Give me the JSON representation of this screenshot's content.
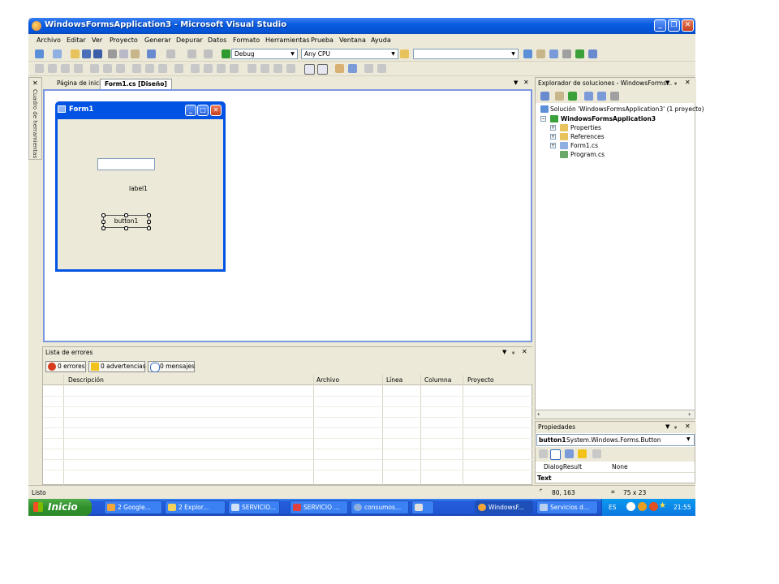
{
  "window": {
    "title": "WindowsFormsApplication3 - Microsoft Visual Studio"
  },
  "menu": [
    "Archivo",
    "Editar",
    "Ver",
    "Proyecto",
    "Generar",
    "Depurar",
    "Datos",
    "Formato",
    "Herramientas",
    "Prueba",
    "Ventana",
    "Ayuda"
  ],
  "toolbar": {
    "config": "Debug",
    "platform": "Any CPU",
    "search": ""
  },
  "toolbox": {
    "label": "Cuadro de herramientas"
  },
  "tabs": [
    {
      "label": "Página de inicio",
      "active": false
    },
    {
      "label": "Form1.cs [Diseño]",
      "active": true
    }
  ],
  "designer": {
    "form_title": "Form1",
    "textbox_value": "",
    "label_text": "label1",
    "button_text": "button1"
  },
  "error_list": {
    "title": "Lista de errores",
    "filters": [
      "0 errores",
      "0 advertencias",
      "0 mensajes"
    ],
    "columns": [
      "Descripción",
      "Archivo",
      "Línea",
      "Columna",
      "Proyecto"
    ],
    "rows": []
  },
  "solution_explorer": {
    "title": "Explorador de soluciones - WindowsForms...",
    "solution": "Solución 'WindowsFormsApplication3' (1 proyecto)",
    "project": "WindowsFormsApplication3",
    "items": [
      "Properties",
      "References",
      "Form1.cs",
      "Program.cs"
    ]
  },
  "properties": {
    "title": "Propiedades",
    "object": "button1",
    "object_type": "System.Windows.Forms.Button",
    "rows": [
      {
        "name": "DialogResult",
        "value": "None"
      },
      {
        "name": "Text",
        "value": ""
      }
    ]
  },
  "status": {
    "text": "Listo",
    "position": "80, 163",
    "size": "75 x 23"
  },
  "taskbar": {
    "start": "Inicio",
    "tasks": [
      "2 Google...",
      "2 Explor...",
      "SERVICIO...",
      "SERVICIO ...",
      "consumos...",
      "",
      "WindowsF...",
      "Servicios d..."
    ],
    "lang": "ES",
    "clock": "21:55"
  },
  "colors": {
    "title_bar": "#0553d6",
    "taskbar": "#245edb",
    "start": "#2f8f2a",
    "designer_border": "#7a96df"
  }
}
